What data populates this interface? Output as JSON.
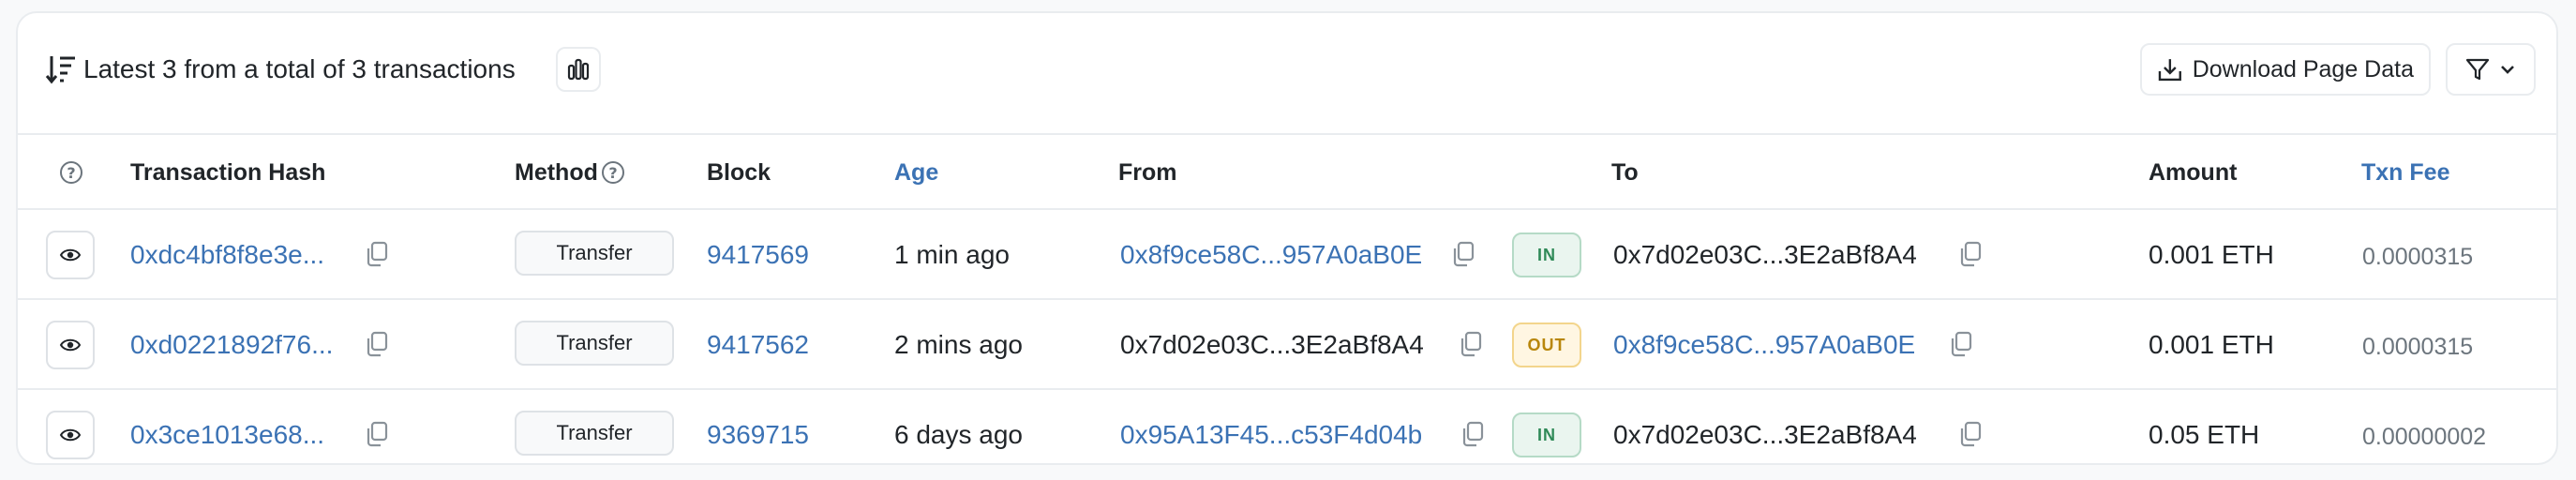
{
  "header": {
    "summary": "Latest 3 from a total of 3 transactions",
    "download_label": "Download Page Data",
    "icons": {
      "sort": "sort-icon",
      "chart": "bar-chart-icon",
      "download": "download-icon",
      "filter": "filter-icon",
      "chevron": "chevron-down-icon"
    }
  },
  "columns": {
    "txn_hash": "Transaction Hash",
    "method": "Method",
    "block": "Block",
    "age": "Age",
    "from": "From",
    "to": "To",
    "amount": "Amount",
    "txn_fee": "Txn Fee",
    "help_glyph": "?"
  },
  "rows": [
    {
      "hash": "0xdc4bf8f8e3e...",
      "method": "Transfer",
      "block": "9417569",
      "age": "1 min ago",
      "from": "0x8f9ce58C...957A0aB0E",
      "direction": "IN",
      "to": "0x7d02e03C...3E2aBf8A4",
      "amount": "0.001 ETH",
      "fee": "0.0000315"
    },
    {
      "hash": "0xd0221892f76...",
      "method": "Transfer",
      "block": "9417562",
      "age": "2 mins ago",
      "from": "0x7d02e03C...3E2aBf8A4",
      "direction": "OUT",
      "to": "0x8f9ce58C...957A0aB0E",
      "amount": "0.001 ETH",
      "fee": "0.0000315"
    },
    {
      "hash": "0x3ce1013e68...",
      "method": "Transfer",
      "block": "9369715",
      "age": "6 days ago",
      "from": "0x95A13F45...c53F4d04b",
      "direction": "IN",
      "to": "0x7d02e03C...3E2aBf8A4",
      "amount": "0.05 ETH",
      "fee": "0.00000002"
    }
  ],
  "colors": {
    "link": "#3b72b4",
    "in_badge": "#2f8a58",
    "out_badge": "#b8860b",
    "border": "#e9ecef"
  }
}
